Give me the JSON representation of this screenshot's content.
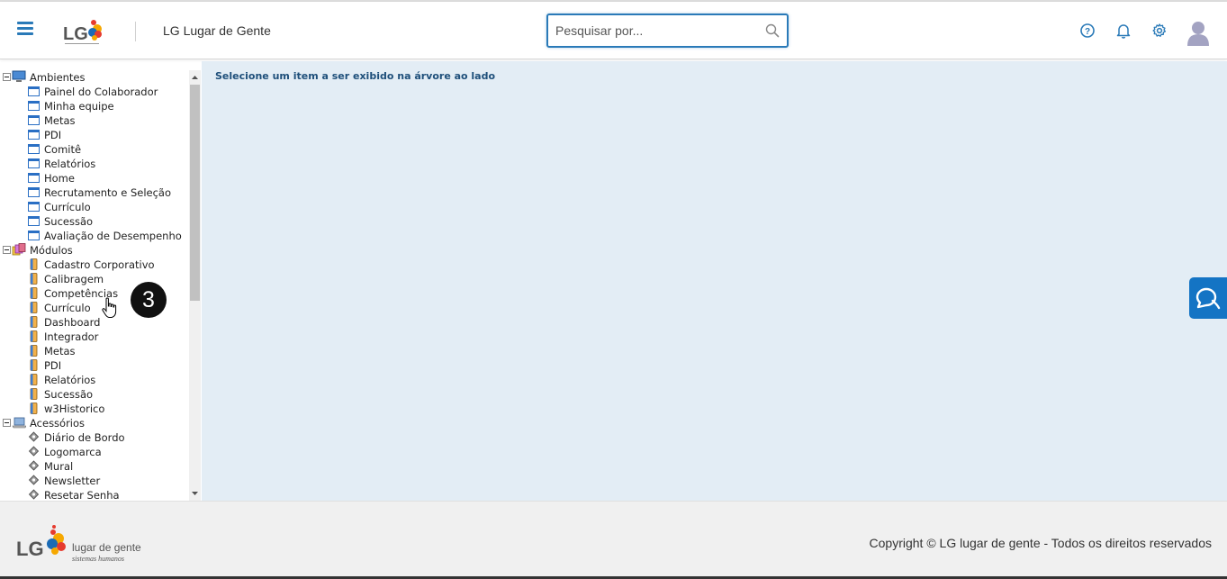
{
  "header": {
    "app_title": "LG Lugar de Gente",
    "search": {
      "placeholder": "Pesquisar por...",
      "value": ""
    },
    "logo_text": "LG",
    "icons": [
      "menu-icon",
      "help-icon",
      "bell-icon",
      "gear-icon",
      "avatar-icon"
    ]
  },
  "tree": {
    "groups": [
      {
        "label": "Ambientes",
        "icon": "monitor-icon",
        "items": [
          "Painel do Colaborador",
          "Minha equipe",
          "Metas",
          "PDI",
          "Comitê",
          "Relatórios",
          "Home",
          "Recrutamento e Seleção",
          "Currículo",
          "Sucessão",
          "Avaliação de Desempenho"
        ]
      },
      {
        "label": "Módulos",
        "icon": "modules-icon",
        "items": [
          "Cadastro Corporativo",
          "Calibragem",
          "Competências",
          "Currículo",
          "Dashboard",
          "Integrador",
          "Metas",
          "PDI",
          "Relatórios",
          "Sucessão",
          "w3Historico"
        ]
      },
      {
        "label": "Acessórios",
        "icon": "laptop-icon",
        "items": [
          "Diário de Bordo",
          "Logomarca",
          "Mural",
          "Newsletter",
          "Resetar Senha"
        ]
      }
    ]
  },
  "content": {
    "message": "Selecione um item a ser exibido na árvore ao lado"
  },
  "annotation": {
    "step_number": "3"
  },
  "footer": {
    "logo_text": "LG",
    "logo_tagline": "lugar de gente",
    "logo_subtagline": "sistemas humanos",
    "copyright": "Copyright © LG lugar de gente - Todos os direitos reservados"
  },
  "colors": {
    "accent": "#2a7ab8",
    "content_bg": "#e3edf5",
    "chat_button": "#1474c4",
    "footer_bg": "#f0f0f0"
  }
}
